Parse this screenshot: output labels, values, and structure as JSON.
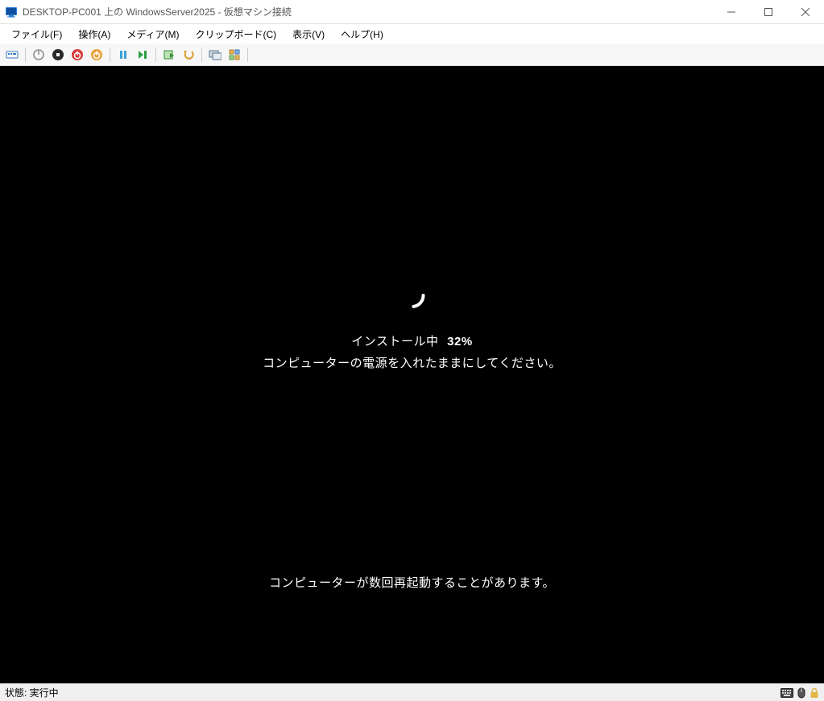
{
  "titlebar": {
    "text": "DESKTOP-PC001 上の WindowsServer2025  - 仮想マシン接続"
  },
  "menubar": {
    "items": [
      "ファイル(F)",
      "操作(A)",
      "メディア(M)",
      "クリップボード(C)",
      "表示(V)",
      "ヘルプ(H)"
    ]
  },
  "install": {
    "progress_label": "インストール中",
    "progress_percent": "32%",
    "keep_on": "コンピューターの電源を入れたままにしてください。",
    "restarts_note": "コンピューターが数回再起動することがあります。"
  },
  "statusbar": {
    "text": "状態: 実行中"
  }
}
